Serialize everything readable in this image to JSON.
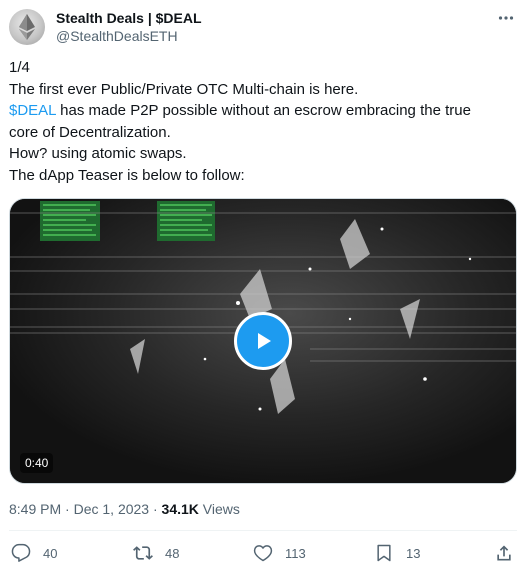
{
  "author": {
    "display_name": "Stealth Deals | $DEAL",
    "handle": "@StealthDealsETH",
    "avatar_icon": "ethereum-logo-icon"
  },
  "tweet": {
    "lines": {
      "l1": "1/4",
      "l2": "The first ever Public/Private OTC Multi-chain is here.",
      "l3_cashtag": "$DEAL",
      "l3_rest": " has made P2P possible without an escrow embracing the true",
      "l4": "core of Decentralization.",
      "l5": "How? using atomic swaps.",
      "l6": "The dApp Teaser is below to follow:"
    },
    "cashtag_color": "#1d9bf0"
  },
  "media": {
    "type": "video",
    "duration": "0:40",
    "play_icon": "play-icon"
  },
  "meta": {
    "time": "8:49 PM",
    "separator": " · ",
    "date": "Dec 1, 2023",
    "views_count": "34.1K",
    "views_label": " Views"
  },
  "actions": {
    "replies": "40",
    "reposts": "48",
    "likes": "113",
    "bookmarks": "13"
  },
  "colors": {
    "accent": "#1d9bf0",
    "text": "#0f1419",
    "secondary": "#536471"
  }
}
